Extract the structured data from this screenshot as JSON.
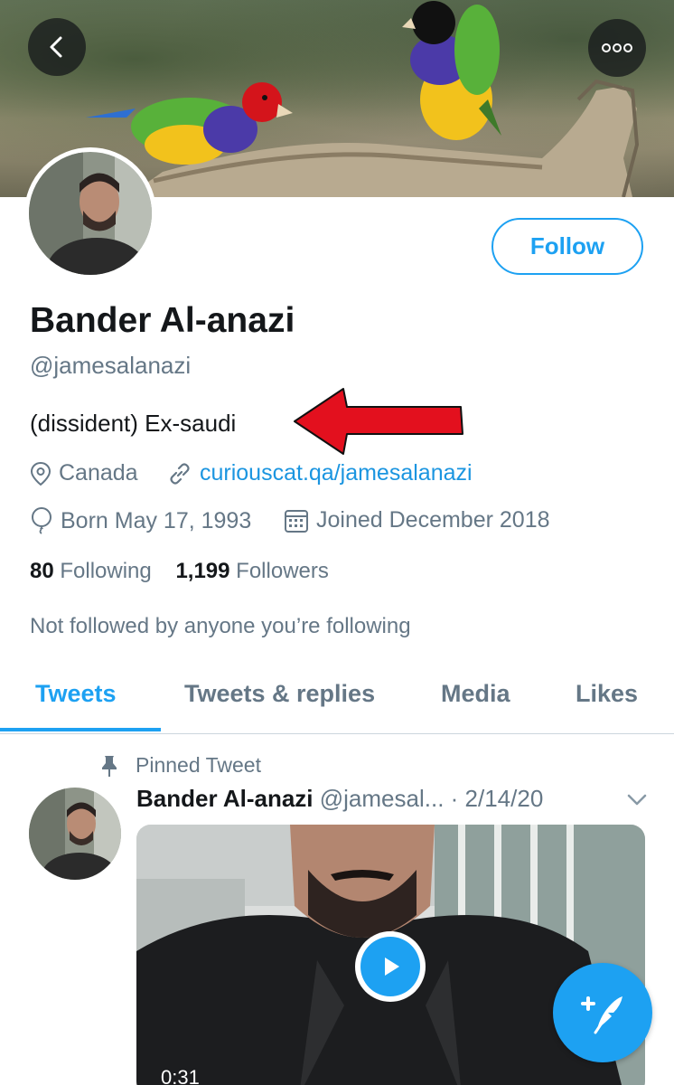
{
  "profile": {
    "name": "Bander Al-anazi",
    "handle": "@jamesalanazi",
    "bio": "(dissident) Ex-saudi",
    "location": "Canada",
    "website": "curiouscat.qa/jamesalanazi",
    "born": "Born May 17, 1993",
    "joined": "Joined December 2018",
    "following_count": "80",
    "following_label": "Following",
    "followers_count": "1,199",
    "followers_label": "Followers",
    "not_followed": "Not followed by anyone you’re following"
  },
  "actions": {
    "follow_label": "Follow"
  },
  "tabs": [
    {
      "label": "Tweets",
      "active": true
    },
    {
      "label": "Tweets & replies",
      "active": false
    },
    {
      "label": "Media",
      "active": false
    },
    {
      "label": "Likes",
      "active": false
    }
  ],
  "pinned_tweet": {
    "pinned_label": "Pinned Tweet",
    "author_name": "Bander Al-anazi",
    "author_handle": "@jamesal...",
    "date": "· 2/14/20",
    "video_duration": "0:31"
  },
  "icons": {
    "back": "chevron-left-icon",
    "more": "more-dots-icon",
    "location": "location-pin-icon",
    "link": "link-icon",
    "birthday": "balloon-icon",
    "joined": "calendar-icon",
    "pin": "pin-icon",
    "caret": "chevron-down-icon",
    "play": "play-icon",
    "compose": "compose-tweet-icon"
  },
  "colors": {
    "accent": "#1da1f2",
    "link": "#1b95e0",
    "secondary_text": "#657786",
    "annotation_arrow": "#e3101e"
  }
}
